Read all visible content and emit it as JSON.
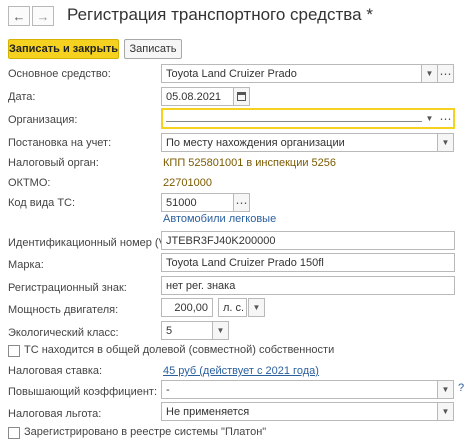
{
  "window": {
    "title": "Регистрация транспортного средства *"
  },
  "toolbar": {
    "save_close_label": "Записать и закрыть",
    "save_label": "Записать"
  },
  "icons": {
    "back": "back-arrow-icon",
    "forward": "forward-arrow-icon",
    "dropdown": "chevron-down-icon",
    "open": "open-form-icon",
    "calendar": "calendar-icon",
    "help": "help-icon"
  },
  "colors": {
    "accent": "#f5d21f",
    "link": "#2a5f9e",
    "info_text": "#7a5a00"
  },
  "form": {
    "asset": {
      "label": "Основное средство:",
      "value": "Toyota Land Cruizer Prado"
    },
    "date": {
      "label": "Дата:",
      "value": "05.08.2021"
    },
    "organization": {
      "label": "Организация:",
      "value": ""
    },
    "registration": {
      "label": "Постановка на учет:",
      "value": "По месту нахождения организации"
    },
    "tax_authority": {
      "label": "Налоговый орган:",
      "value": "КПП 525801001 в инспекции 5256"
    },
    "oktmo": {
      "label": "ОКТМО:",
      "value": "22701000"
    },
    "vehicle_code": {
      "label": "Код вида ТС:",
      "value": "51000",
      "hint": "Автомобили легковые"
    },
    "vin": {
      "label": "Идентификационный номер (VIN):",
      "value": "JTEBR3FJ40K200000"
    },
    "brand": {
      "label": "Марка:",
      "value": "Toyota Land Cruizer Prado 150fl"
    },
    "reg_plate": {
      "label": "Регистрационный знак:",
      "value": "нет рег. знака"
    },
    "power": {
      "label": "Мощность двигателя:",
      "value": "200,00",
      "unit": "л. с."
    },
    "eco_class": {
      "label": "Экологический класс:",
      "value": "5"
    },
    "shared_ownership": {
      "label": "ТС находится в общей долевой (совместной) собственности",
      "checked": false
    },
    "tax_rate": {
      "label": "Налоговая ставка:",
      "value": "45 руб (действует с 2021 года)"
    },
    "coef": {
      "label": "Повышающий коэффициент:",
      "value": "-",
      "help": "?"
    },
    "benefit": {
      "label": "Налоговая льгота:",
      "value": "Не применяется"
    },
    "platon": {
      "label": "Зарегистрировано в реестре системы \"Платон\"",
      "checked": false
    }
  }
}
